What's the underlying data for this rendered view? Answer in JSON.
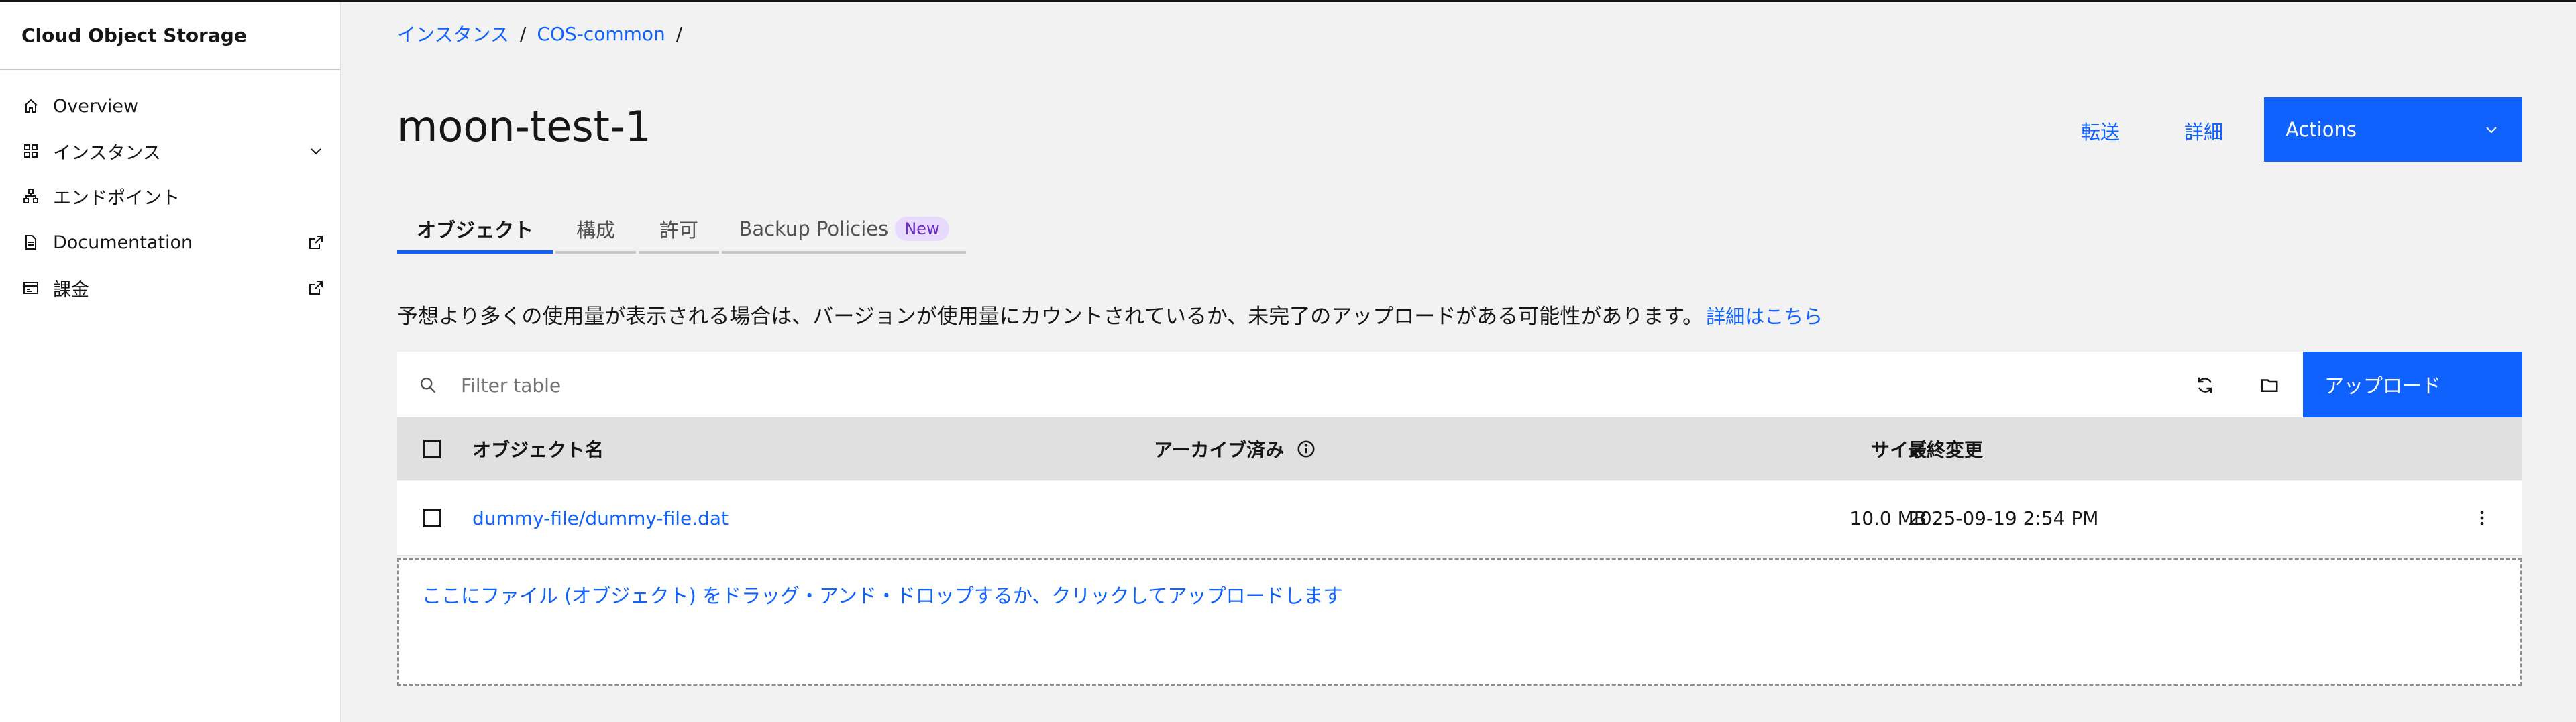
{
  "sidebar": {
    "title": "Cloud Object Storage",
    "items": [
      {
        "label": "Overview",
        "icon": "home-icon"
      },
      {
        "label": "インスタンス",
        "icon": "grid-icon"
      },
      {
        "label": "エンドポイント",
        "icon": "hierarchy-icon"
      },
      {
        "label": "Documentation",
        "icon": "document-icon"
      },
      {
        "label": "課金",
        "icon": "billing-icon"
      }
    ]
  },
  "breadcrumb": [
    "インスタンス",
    "COS-common"
  ],
  "bucket": {
    "title": "moon-test-1"
  },
  "header": {
    "transfer": "転送",
    "details": "詳細",
    "actions": "Actions"
  },
  "tabs": [
    {
      "label": "オブジェクト"
    },
    {
      "label": "構成"
    },
    {
      "label": "許可"
    },
    {
      "label": "Backup Policies",
      "badge": "New"
    }
  ],
  "notice": {
    "text": "予想より多くの使用量が表示される場合は、バージョンが使用量にカウントされているか、未完了のアップロードがある可能性があります。",
    "link": "詳細はこちら"
  },
  "table": {
    "filter_placeholder": "Filter table",
    "upload": "アップロード",
    "columns": {
      "name": "オブジェクト名",
      "archived": "アーカイブ済み",
      "size": "サイズ",
      "modified": "最終変更"
    },
    "rows": [
      {
        "name": "dummy-file/dummy-file.dat",
        "size": "10.0 MB",
        "modified": "2025-09-19 2:54 PM"
      }
    ]
  },
  "dropzone": {
    "text": "ここにファイル (オブジェクト) をドラッグ・アンド・ドロップするか、クリックしてアップロードします"
  },
  "colors": {
    "accent": "#0f62fe",
    "badge_bg": "#e8daff",
    "badge_fg": "#6929c4"
  }
}
